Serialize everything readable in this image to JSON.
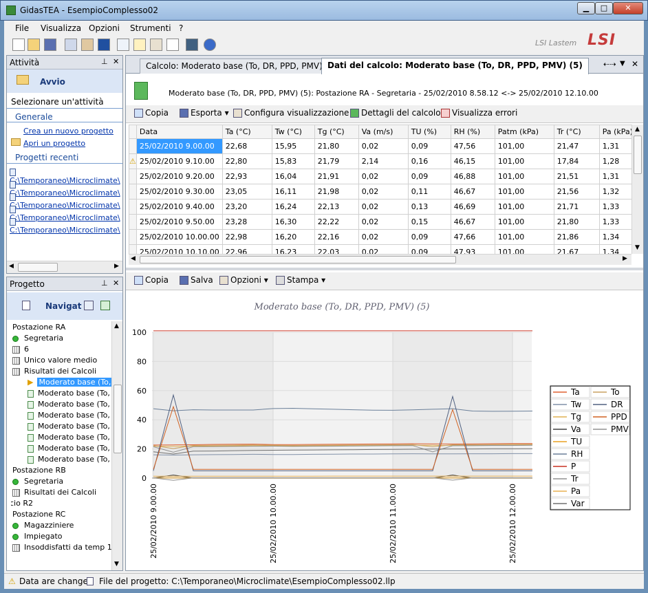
{
  "window": {
    "title": "GidasTEA - EsempioComplesso02"
  },
  "menu": [
    "File",
    "Visualizza",
    "Opzioni",
    "Strumenti",
    "?"
  ],
  "brand": {
    "lsi_text": "LSI Lastem",
    "logo": "LSI"
  },
  "activity": {
    "title": "Attività",
    "avvio": "Avvio",
    "select": "Selezionare un'attività",
    "general": "Generale",
    "create": "Crea un nuovo progetto",
    "open": "Apri un progetto",
    "recent": "Progetti recenti",
    "recent_items": [
      "C:\\Temporaneo\\Microclimate\\",
      "C:\\Temporaneo\\Microclimate\\",
      "C:\\Temporaneo\\Microclimate\\",
      "C:\\Temporaneo\\Microclimate\\",
      "C:\\Temporaneo\\Microclimate\\"
    ]
  },
  "project": {
    "title": "Progetto",
    "navigator": "Navigat",
    "tree": [
      "Postazione RA",
      "Segretaria",
      "6",
      "Unico valore medio",
      "Risultati dei Calcoli",
      "Moderato base (To, I",
      "Moderato base (To, I",
      "Moderato base (To, I",
      "Moderato base (To, I",
      "Moderato base (To, I",
      "Moderato base (To, I",
      "Moderato base (To, I",
      "Moderato base (To, I",
      "Postazione RB",
      "Segretaria",
      "Risultati dei Calcoli",
      "cio R2",
      "Postazione RC",
      "Magazziniere",
      "Impiegato",
      "Insoddisfatti da temp 1"
    ]
  },
  "tabs": [
    "Calcolo: Moderato base (To, DR, PPD, PMV) (5)",
    "Dati del calcolo: Moderato base (To, DR, PPD, PMV) (5)"
  ],
  "calc_header": "Moderato base (To, DR, PPD, PMV) (5): Postazione RA - Segretaria - 25/02/2010 8.58.12 <-> 25/02/2010 12.10.00",
  "data_toolbar": {
    "copy": "Copia",
    "export": "Esporta",
    "configure": "Configura visualizzazione",
    "details": "Dettagli del calcolo",
    "errors": "Visualizza errori"
  },
  "table": {
    "headers": [
      "Data",
      "Ta (°C)",
      "Tw (°C)",
      "Tg (°C)",
      "Va (m/s)",
      "TU (%)",
      "RH (%)",
      "Patm (kPa)",
      "Tr (°C)",
      "Pa (kPa)"
    ],
    "rows": [
      [
        "25/02/2010 9.00.00",
        "22,68",
        "15,95",
        "21,80",
        "0,02",
        "0,09",
        "47,56",
        "101,00",
        "21,47",
        "1,31"
      ],
      [
        "25/02/2010 9.10.00",
        "22,80",
        "15,83",
        "21,79",
        "2,14",
        "0,16",
        "46,15",
        "101,00",
        "17,84",
        "1,28"
      ],
      [
        "25/02/2010 9.20.00",
        "22,93",
        "16,04",
        "21,91",
        "0,02",
        "0,09",
        "46,88",
        "101,00",
        "21,51",
        "1,31"
      ],
      [
        "25/02/2010 9.30.00",
        "23,05",
        "16,11",
        "21,98",
        "0,02",
        "0,11",
        "46,67",
        "101,00",
        "21,56",
        "1,32"
      ],
      [
        "25/02/2010 9.40.00",
        "23,20",
        "16,24",
        "22,13",
        "0,02",
        "0,13",
        "46,69",
        "101,00",
        "21,71",
        "1,33"
      ],
      [
        "25/02/2010 9.50.00",
        "23,28",
        "16,30",
        "22,22",
        "0,02",
        "0,15",
        "46,67",
        "101,00",
        "21,80",
        "1,33"
      ],
      [
        "25/02/2010 10.00.00",
        "22,98",
        "16,20",
        "22,16",
        "0,02",
        "0,09",
        "47,66",
        "101,00",
        "21,86",
        "1,34"
      ],
      [
        "25/02/2010 10.10.00",
        "22,96",
        "16,23",
        "22,03",
        "0,02",
        "0,09",
        "47,93",
        "101,00",
        "21,67",
        "1,34"
      ]
    ]
  },
  "chart_toolbar": {
    "copy": "Copia",
    "save": "Salva",
    "options": "Opzioni",
    "print": "Stampa"
  },
  "chart_data": {
    "type": "line",
    "title": "Moderato base (To, DR, PPD, PMV) (5)",
    "ylim": [
      0,
      100
    ],
    "yticks": [
      "100",
      "80",
      "60",
      "40",
      "20",
      "0"
    ],
    "xticks": [
      "25/02/2010 9.00.00",
      "25/02/2010 10.00.00",
      "25/02/2010 11.00.00",
      "25/02/2010 12.00.00"
    ],
    "grid": true,
    "legend_position": "right",
    "x_minutes": [
      0,
      10,
      20,
      30,
      40,
      50,
      60,
      70,
      80,
      90,
      100,
      110,
      120,
      130,
      140,
      150,
      160,
      170,
      180,
      190
    ],
    "series": [
      {
        "name": "Ta",
        "color": "#e06030",
        "values": [
          22.7,
          22.8,
          22.9,
          23.1,
          23.2,
          23.3,
          23.0,
          23.0,
          23.1,
          23.2,
          23.3,
          23.4,
          23.5,
          23.6,
          23.5,
          23.4,
          23.5,
          23.6,
          23.7,
          23.7
        ]
      },
      {
        "name": "Tw",
        "color": "#8090a8",
        "values": [
          16.0,
          15.8,
          16.0,
          16.1,
          16.2,
          16.3,
          16.2,
          16.2,
          16.3,
          16.4,
          16.5,
          16.5,
          16.6,
          16.7,
          16.6,
          16.6,
          16.7,
          16.7,
          16.8,
          16.8
        ]
      },
      {
        "name": "Tg",
        "color": "#e0b050",
        "values": [
          21.8,
          21.8,
          21.9,
          22.0,
          22.1,
          22.2,
          22.2,
          22.0,
          22.1,
          22.2,
          22.3,
          22.4,
          22.5,
          22.6,
          22.5,
          22.4,
          22.5,
          22.6,
          22.6,
          22.7
        ]
      },
      {
        "name": "Va",
        "color": "#404040",
        "values": [
          0.02,
          2.14,
          0.02,
          0.02,
          0.02,
          0.02,
          0.02,
          0.02,
          0.02,
          0.02,
          0.02,
          0.02,
          0.02,
          0.02,
          0.02,
          2.1,
          0.02,
          0.02,
          0.02,
          0.02
        ]
      },
      {
        "name": "TU",
        "color": "#e8a020",
        "values": [
          0.09,
          0.16,
          0.09,
          0.11,
          0.13,
          0.15,
          0.09,
          0.09,
          0.1,
          0.1,
          0.1,
          0.1,
          0.1,
          0.1,
          0.1,
          0.15,
          0.1,
          0.1,
          0.1,
          0.1
        ]
      },
      {
        "name": "RH",
        "color": "#6a7f99",
        "values": [
          47.6,
          46.2,
          46.9,
          46.7,
          46.7,
          46.7,
          47.7,
          47.9,
          47.5,
          47.2,
          46.9,
          46.6,
          46.5,
          46.8,
          47.2,
          47.6,
          46.0,
          45.8,
          45.9,
          46.0
        ]
      },
      {
        "name": "P",
        "color": "#c83020",
        "values": [
          101,
          101,
          101,
          101,
          101,
          101,
          101,
          101,
          101,
          101,
          101,
          101,
          101,
          101,
          101,
          101,
          101,
          101,
          101,
          101
        ]
      },
      {
        "name": "Tr",
        "color": "#909090",
        "values": [
          21.5,
          17.8,
          21.5,
          21.6,
          21.7,
          21.8,
          21.9,
          21.7,
          21.8,
          21.9,
          22.0,
          22.1,
          22.2,
          22.3,
          18.0,
          22.2,
          22.3,
          22.4,
          22.4,
          22.5
        ]
      },
      {
        "name": "Pa",
        "color": "#e8b050",
        "values": [
          1.31,
          1.28,
          1.31,
          1.32,
          1.33,
          1.33,
          1.34,
          1.34,
          1.34,
          1.35,
          1.35,
          1.35,
          1.36,
          1.36,
          1.36,
          1.36,
          1.37,
          1.37,
          1.37,
          1.38
        ]
      },
      {
        "name": "Var",
        "color": "#707070",
        "values": [
          18,
          16.5,
          18.5,
          18.6,
          18.8,
          19,
          19.1,
          19.2,
          19.3,
          19.4,
          19.5,
          19.6,
          19.7,
          19.8,
          19.9,
          20,
          20,
          20.1,
          20.1,
          20.2
        ]
      },
      {
        "name": "To",
        "color": "#c8a060",
        "values": [
          22.3,
          20.3,
          22.4,
          22.5,
          22.6,
          22.7,
          22.6,
          22.4,
          22.5,
          22.6,
          22.7,
          22.8,
          22.9,
          23.0,
          21.5,
          22.9,
          22.9,
          23.0,
          23.1,
          23.1
        ]
      },
      {
        "name": "DR",
        "color": "#506080",
        "values": [
          5,
          57,
          5,
          5,
          5,
          5,
          5,
          5,
          5,
          5,
          5,
          5,
          5,
          5,
          5,
          56,
          5,
          5,
          5,
          5
        ]
      },
      {
        "name": "PPD",
        "color": "#d06020",
        "values": [
          6,
          49,
          6,
          6,
          6,
          6,
          6,
          6,
          6,
          6,
          6,
          6,
          6,
          6,
          6,
          47,
          6,
          6,
          6,
          6
        ]
      },
      {
        "name": "PMV",
        "color": "#909090",
        "values": [
          0.2,
          -1.5,
          0.2,
          0.2,
          0.2,
          0.2,
          0.2,
          0.2,
          0.2,
          0.2,
          0.2,
          0.2,
          0.2,
          0.2,
          0.2,
          -1.4,
          0.2,
          0.2,
          0.2,
          0.2
        ]
      }
    ]
  },
  "status": {
    "warning": "Data are changed",
    "file": "File del progetto: C:\\Temporaneo\\Microclimate\\EsempioComplesso02.llp"
  }
}
